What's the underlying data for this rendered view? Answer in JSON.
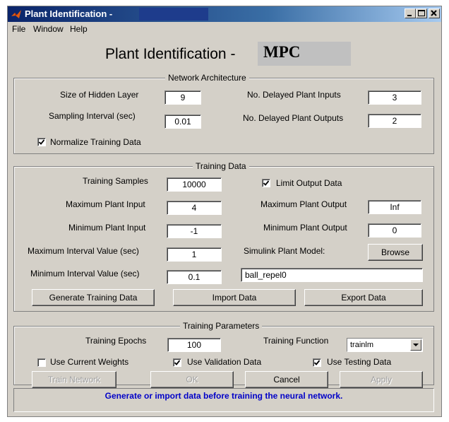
{
  "window": {
    "title": "Plant Identification -",
    "controls": {
      "minimize": "_",
      "maximize": "□",
      "close": "×"
    }
  },
  "menu": [
    "File",
    "Window",
    "Help"
  ],
  "heading": {
    "text": "Plant Identification -",
    "model": "MPC"
  },
  "network_architecture": {
    "title": "Network Architecture",
    "hidden_layer_label": "Size of Hidden Layer",
    "hidden_layer_value": "9",
    "sampling_label": "Sampling Interval (sec)",
    "sampling_value": "0.01",
    "delayed_inputs_label": "No. Delayed Plant Inputs",
    "delayed_inputs_value": "3",
    "delayed_outputs_label": "No. Delayed Plant Outputs",
    "delayed_outputs_value": "2",
    "normalize_label": "Normalize Training Data",
    "normalize_checked": true
  },
  "training_data": {
    "title": "Training Data",
    "samples_label": "Training Samples",
    "samples_value": "10000",
    "limit_output_label": "Limit Output Data",
    "limit_output_checked": true,
    "max_input_label": "Maximum Plant Input",
    "max_input_value": "4",
    "max_output_label": "Maximum Plant Output",
    "max_output_value": "Inf",
    "min_input_label": "Minimum Plant Input",
    "min_input_value": "-1",
    "min_output_label": "Minimum Plant Output",
    "min_output_value": "0",
    "max_interval_label": "Maximum Interval Value (sec)",
    "max_interval_value": "1",
    "min_interval_label": "Minimum Interval Value (sec)",
    "min_interval_value": "0.1",
    "simulink_label": "Simulink Plant Model:",
    "browse_label": "Browse",
    "model_value": "ball_repel0",
    "generate_label": "Generate Training Data",
    "import_label": "Import Data",
    "export_label": "Export Data"
  },
  "training_parameters": {
    "title": "Training Parameters",
    "epochs_label": "Training Epochs",
    "epochs_value": "100",
    "function_label": "Training Function",
    "function_value": "trainlm",
    "use_current_label": "Use Current Weights",
    "use_current_checked": false,
    "use_validation_label": "Use Validation Data",
    "use_validation_checked": true,
    "use_testing_label": "Use Testing Data",
    "use_testing_checked": true
  },
  "actions": {
    "train_label": "Train Network",
    "ok_label": "OK",
    "cancel_label": "Cancel",
    "apply_label": "Apply"
  },
  "status": "Generate or import data before training the neural network.",
  "colors": {
    "title_bar_start": "#0a246a",
    "title_bar_end": "#a6caf0",
    "panel": "#d4d0c8",
    "status_text": "#0000c8"
  },
  "icons": [
    "matlab-logo-icon",
    "minimize-icon",
    "maximize-icon",
    "close-icon",
    "checkmark-icon",
    "dropdown-arrow-icon"
  ]
}
